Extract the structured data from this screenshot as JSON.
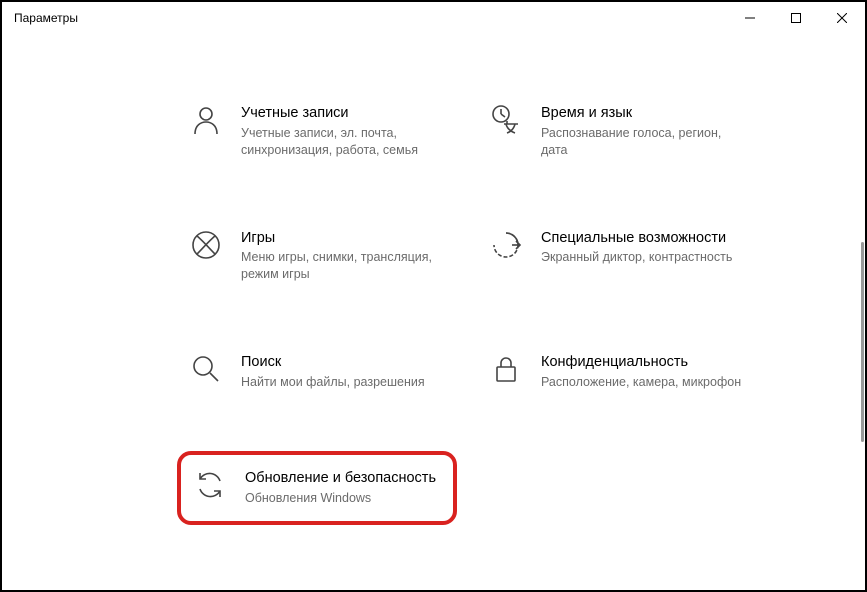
{
  "window": {
    "title": "Параметры"
  },
  "tiles": {
    "accounts": {
      "title": "Учетные записи",
      "desc": "Учетные записи, эл. почта, синхронизация, работа, семья"
    },
    "time": {
      "title": "Время и язык",
      "desc": "Распознавание голоса, регион, дата"
    },
    "games": {
      "title": "Игры",
      "desc": "Меню игры, снимки, трансляция, режим игры"
    },
    "ease": {
      "title": "Специальные возможности",
      "desc": "Экранный диктор, контрастность"
    },
    "search": {
      "title": "Поиск",
      "desc": "Найти мои файлы, разрешения"
    },
    "privacy": {
      "title": "Конфиденциальность",
      "desc": "Расположение, камера, микрофон"
    },
    "update": {
      "title": "Обновление и безопасность",
      "desc": "Обновления Windows"
    }
  }
}
